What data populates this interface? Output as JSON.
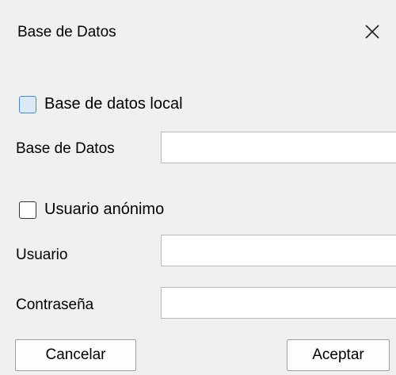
{
  "window": {
    "title": "Base de Datos",
    "close_icon": "close-icon"
  },
  "local_db": {
    "checkbox_label": "Base de datos local",
    "checked": false,
    "field_label": "Base de Datos",
    "field_value": ""
  },
  "anonymous": {
    "checkbox_label": "Usuario anónimo",
    "checked": false
  },
  "user": {
    "field_label": "Usuario",
    "field_value": ""
  },
  "password": {
    "field_label": "Contraseña",
    "field_value": ""
  },
  "buttons": {
    "cancel_label": "Cancelar",
    "accept_label": "Aceptar"
  },
  "colors": {
    "background": "#f0f0f0",
    "focus_accent": "#4a87c6"
  }
}
